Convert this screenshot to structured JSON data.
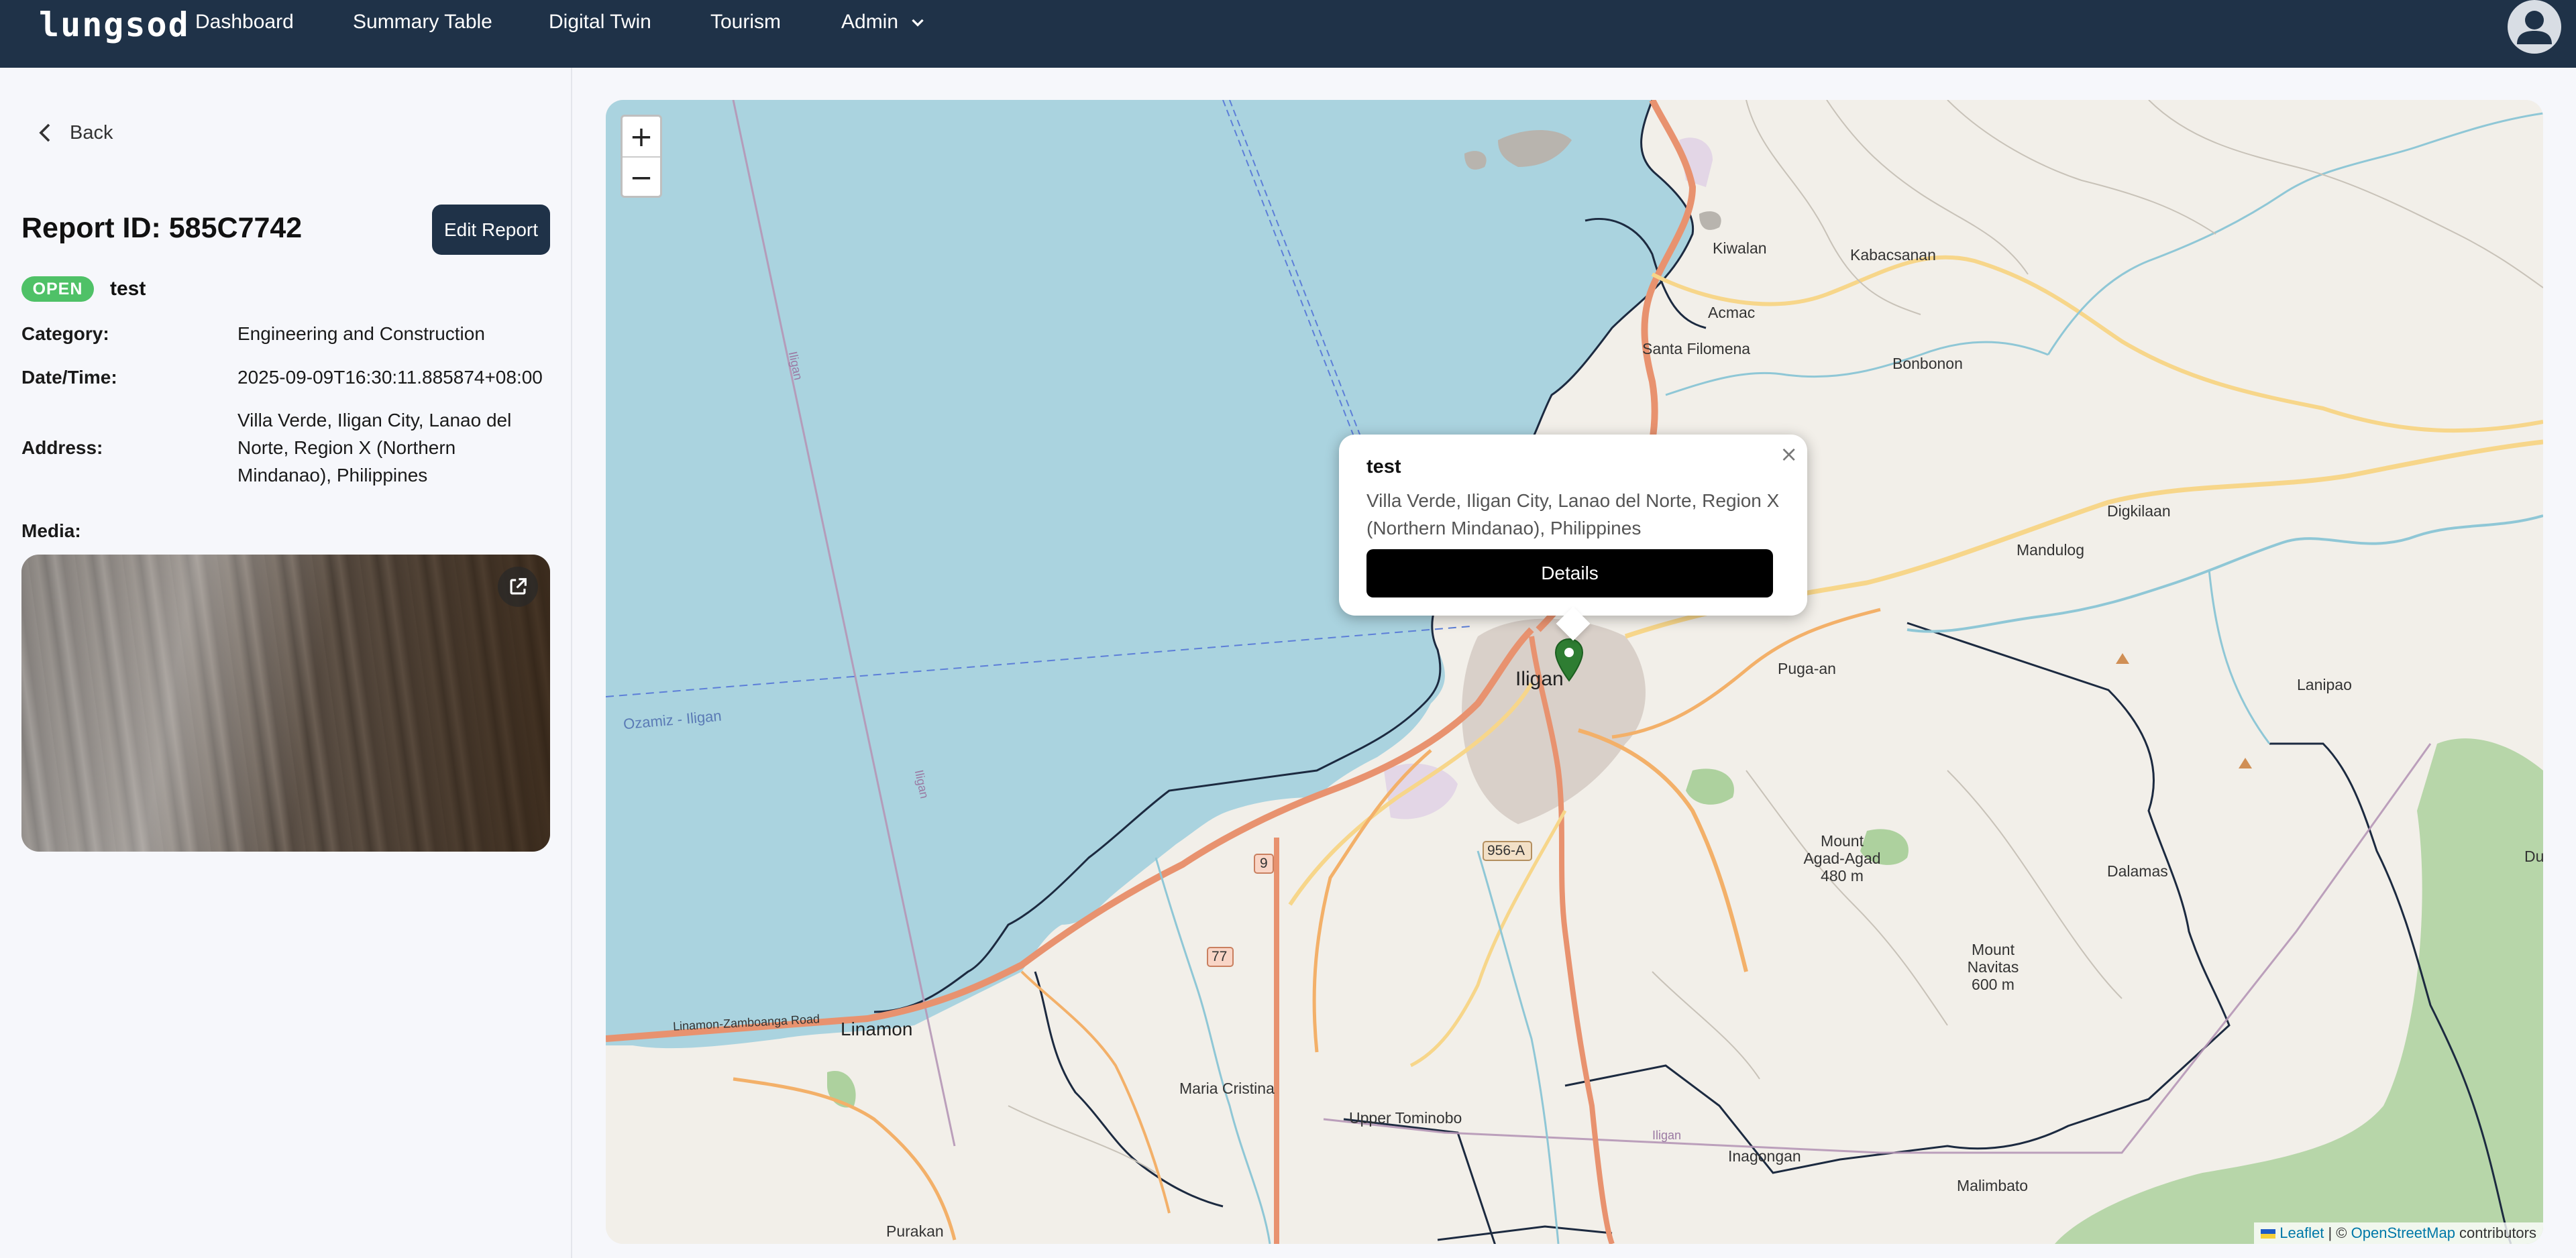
{
  "navbar": {
    "brand": "lungsod",
    "links": [
      "Dashboard",
      "Summary Table",
      "Digital Twin",
      "Tourism"
    ],
    "admin_label": "Admin"
  },
  "sidebar": {
    "back_label": "Back",
    "report_title": "Report ID: 585C7742",
    "edit_label": "Edit Report",
    "status": "OPEN",
    "report_name": "test",
    "fields": {
      "category_label": "Category:",
      "category_value": "Engineering and Construction",
      "datetime_label": "Date/Time:",
      "datetime_value": "2025-09-09T16:30:11.885874+08:00",
      "address_label": "Address:",
      "address_value": "Villa Verde, Iligan City, Lanao del Norte, Region X (Northern Mindanao), Philippines",
      "media_label": "Media:"
    }
  },
  "map": {
    "zoom_in": "+",
    "zoom_out": "−",
    "labels": {
      "kiwalan": "Kiwalan",
      "kabacsanan": "Kabacsanan",
      "acmac": "Acmac",
      "santa_filomena": "Santa Filomena",
      "bonbonon": "Bonbonon",
      "digkilaan": "Digkilaan",
      "mandulog": "Mandulog",
      "iligan": "Iligan",
      "puga_an": "Puga-an",
      "lanipao": "Lanipao",
      "ozamiz_iligan": "Ozamiz - Iligan",
      "mount_agad_1": "Mount",
      "mount_agad_2": "Agad-Agad",
      "mount_agad_3": "480 m",
      "mount_navitas_1": "Mount",
      "mount_navitas_2": "Navitas",
      "mount_navitas_3": "600 m",
      "dalamas": "Dalamas",
      "road_956a": "956-A",
      "road_9": "9",
      "road_77": "77",
      "linamon": "Linamon",
      "linamon_road": "Linamon-Zamboanga Road",
      "maria_cristina": "Maria Cristina",
      "upper_tominobo": "Upper Tominobo",
      "inagongan": "Inagongan",
      "malimbato": "Malimbato",
      "purakan": "Purakan",
      "iligan_water_1": "Iligan",
      "iligan_water_2": "Iligan",
      "iligan_line": "Iligan",
      "du": "Du"
    },
    "attribution": {
      "leaflet": "Leaflet",
      "separator": " | © ",
      "osm": "OpenStreetMap",
      "suffix": " contributors"
    },
    "colors": {
      "water": "#aad3df",
      "land": "#f2efe9",
      "urban": "#d9d0c9",
      "boundary": "#1c2a40",
      "primary_road": "#e8926f",
      "secondary_road": "#f7d68a",
      "river": "#8fc7d6",
      "forest": "#add19e",
      "marker": "#2e7d32"
    }
  },
  "popup": {
    "close": "×",
    "title": "test",
    "address": "Villa Verde, Iligan City, Lanao del Norte, Region X (Northern Mindanao), Philippines",
    "details_label": "Details"
  },
  "colors": {
    "navbar": "#1f3248",
    "status_open": "#4fc167",
    "details_button": "#000000"
  }
}
